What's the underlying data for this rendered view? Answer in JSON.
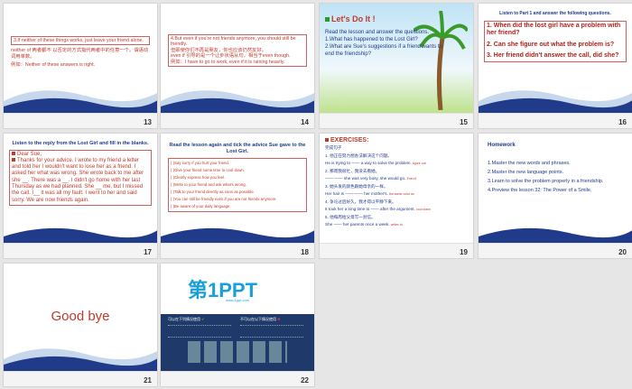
{
  "slides": [
    {
      "num": "13",
      "lines": [
        "3.If neither of these things works, just leave your friend alone.",
        "neither of 两者都不 以否定的方式指代两者中的任意一个。谓语动词用单数。",
        "例如：Neither of these answers is right."
      ]
    },
    {
      "num": "14",
      "lines": [
        "4.But even if you're not friends anymore, you should still be friendly.",
        "但即使你们不再是朋友，你也应该仍然友好。",
        "even if 引导的是一个让步状语从句，相当于even though.",
        "例如：I have to go to work, even if it is raining heavily."
      ]
    },
    {
      "num": "15",
      "title": "Let's Do It !",
      "lines": [
        "Read the lesson and answer the questions.",
        "1.What has happened to the Lost Girl?",
        "2.What are Sue's suggestions if a friend wants to end the friendship?"
      ]
    },
    {
      "num": "16",
      "header": "Listen to Part 1 and answer the following questions.",
      "questions": [
        "1. When did the lost girl have a problem with her friend?",
        "2. Can she figure out what the problem is?",
        "3. Her friend didn't answer the call, did she?"
      ]
    },
    {
      "num": "17",
      "title": "Listen to the reply from the Lost Girl and fill in the blanks.",
      "lines": [
        "Dear Sue,",
        "Thanks for your advice. I wrote to my friend a letter and told her I wouldn't want to lose her as a friend. I asked her what was wrong. She wrote back to me after she __. There was a __. I didn't go home with her last Thursday as we had planned. She __ me, but I missed the call. I__ it was all my fault. I went to her and said sorry. We are now friends again."
      ]
    },
    {
      "num": "18",
      "title": "Read the lesson again and tick the advice Sue gave to the Lost Girl.",
      "items": [
        "( )Say sorry if you hurt your friend.",
        "( )Give your friend some time to cool down.",
        "( )Clearly express how you feel.",
        "( )Write to your friend and ask what's wrong.",
        "( )Talk to your friend directly as soon as possible.",
        "( )You can still be friendly even if you are not friends anymore.",
        "( )Be aware of your daily language."
      ]
    },
    {
      "num": "19",
      "title": "EXERCISES:",
      "lines": [
        "完成句子",
        "1.  他正在努力想办法解决这个问题。",
        "He is trying to —— a way to solve the problem.",
        "2. 那周我很忙，我没去看她。",
        "—— —— she was very busy, she would go.",
        "3. 她头发的颜色跟她母亲的一样。",
        "Her hair is —— —— her mother's.",
        "4. 争论过后好久，我才得以平静下来。",
        "It took her a long time to —— after the argument.",
        "5. 他每周给父母写一封信。",
        "She —— her parents once a week."
      ],
      "notes": [
        "figure out",
        "Even if",
        "the same color as",
        "cool down",
        "writes to"
      ]
    },
    {
      "num": "20",
      "title": "Homework",
      "lines": [
        "1.Master the new words and phrases.",
        "2.Master the new language points.",
        "3.Learn to solve the problem properly in a friendship.",
        "4.Preview the lesson 32: The Power of a Smile."
      ]
    },
    {
      "num": "21",
      "text": "Good bye"
    },
    {
      "num": "22",
      "logo": "第1PPT",
      "subtitle": "www.1ppt.com",
      "left_head": "可以在下列情况使用",
      "right_head": "不可以在以下情况使用"
    }
  ]
}
